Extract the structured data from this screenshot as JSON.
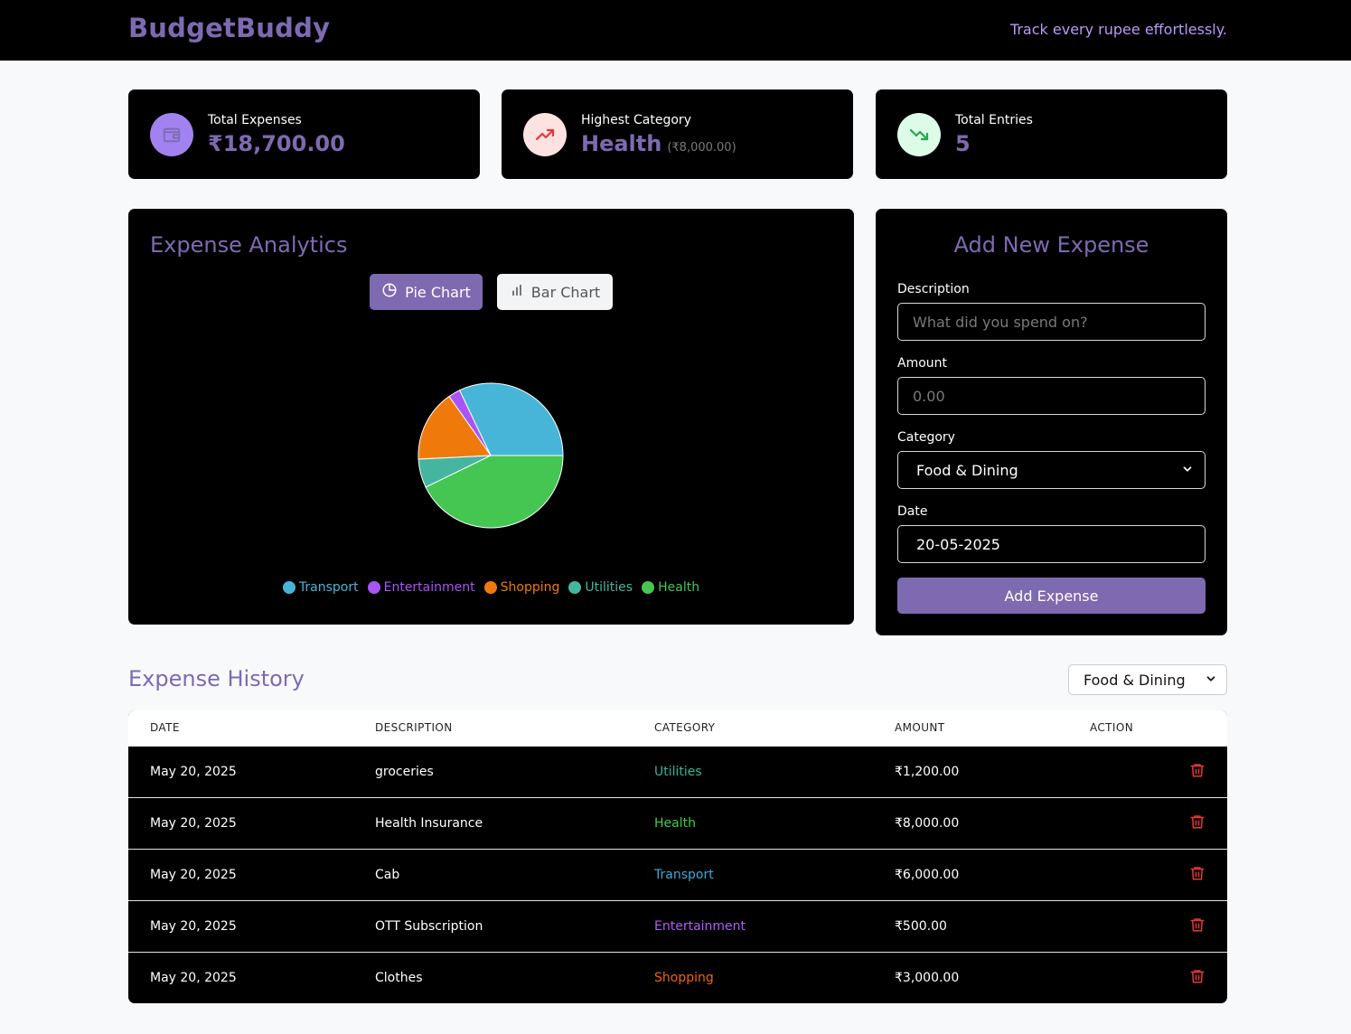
{
  "header": {
    "brand": "BudgetBuddy",
    "tagline": "Track every rupee effortlessly."
  },
  "stats": [
    {
      "label": "Total Expenses",
      "value": "₹18,700.00",
      "icon": "wallet-icon",
      "icon_bg": "#a182f0"
    },
    {
      "label": "Highest Category",
      "value": "Health",
      "sub": "(₹8,000.00)",
      "icon": "trending-up-icon",
      "icon_bg": "#fde2e2"
    },
    {
      "label": "Total Entries",
      "value": "5",
      "icon": "trending-down-icon",
      "icon_bg": "#dcfce7"
    }
  ],
  "analytics": {
    "title": "Expense Analytics",
    "pie_button": "Pie Chart",
    "bar_button": "Bar Chart",
    "active_view": "Pie Chart"
  },
  "chart_data": {
    "type": "pie",
    "categories": [
      "Transport",
      "Entertainment",
      "Shopping",
      "Utilities",
      "Health"
    ],
    "values": [
      6000,
      500,
      3000,
      1200,
      8000
    ],
    "colors": [
      "#47b5d8",
      "#a855f7",
      "#ef7a0b",
      "#45b5a0",
      "#45c653"
    ],
    "legend": "bottom"
  },
  "form": {
    "title": "Add New Expense",
    "description_label": "Description",
    "description_placeholder": "What did you spend on?",
    "amount_label": "Amount",
    "amount_placeholder": "0.00",
    "category_label": "Category",
    "category_value": "Food & Dining",
    "date_label": "Date",
    "date_value": "20-05-2025",
    "submit": "Add Expense"
  },
  "history": {
    "title": "Expense History",
    "filter_value": "Food & Dining",
    "columns": [
      "DATE",
      "DESCRIPTION",
      "CATEGORY",
      "AMOUNT",
      "ACTION"
    ],
    "rows": [
      {
        "date": "May 20, 2025",
        "description": "groceries",
        "category": "Utilities",
        "category_color": "#2fb59b",
        "amount": "₹1,200.00"
      },
      {
        "date": "May 20, 2025",
        "description": "Health Insurance",
        "category": "Health",
        "category_color": "#3fcf4f",
        "amount": "₹8,000.00"
      },
      {
        "date": "May 20, 2025",
        "description": "Cab",
        "category": "Transport",
        "category_color": "#3aa9dd",
        "amount": "₹6,000.00"
      },
      {
        "date": "May 20, 2025",
        "description": "OTT Subscription",
        "category": "Entertainment",
        "category_color": "#b15cf5",
        "amount": "₹500.00"
      },
      {
        "date": "May 20, 2025",
        "description": "Clothes",
        "category": "Shopping",
        "category_color": "#f0640f",
        "amount": "₹3,000.00"
      }
    ]
  },
  "colors": {
    "accent": "#7e6ab1",
    "danger": "#e53935",
    "panel": "#000000",
    "page_bg": "#f8f9fb"
  }
}
